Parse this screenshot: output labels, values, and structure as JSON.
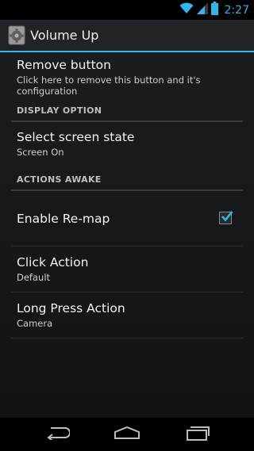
{
  "status_bar": {
    "time": "2:27"
  },
  "action_bar": {
    "title": "Volume Up"
  },
  "items": {
    "remove": {
      "title": "Remove button",
      "subtitle": "Click here to remove this button and it's configuration"
    },
    "display_header": "DISPLAY OPTION",
    "screen_state": {
      "title": "Select screen state",
      "subtitle": "Screen On"
    },
    "actions_header": "ACTIONS AWAKE",
    "enable_remap": {
      "title": "Enable Re-map",
      "checked": true
    },
    "click_action": {
      "title": "Click Action",
      "subtitle": "Default"
    },
    "long_press": {
      "title": "Long Press Action",
      "subtitle": "Camera"
    }
  },
  "colors": {
    "accent": "#33b5e5",
    "background": "#1b1d20"
  },
  "icons": [
    "wifi-icon",
    "signal-icon",
    "battery-icon",
    "settings-gear-icon",
    "back-icon",
    "home-icon",
    "recent-apps-icon",
    "checkmark-icon"
  ]
}
